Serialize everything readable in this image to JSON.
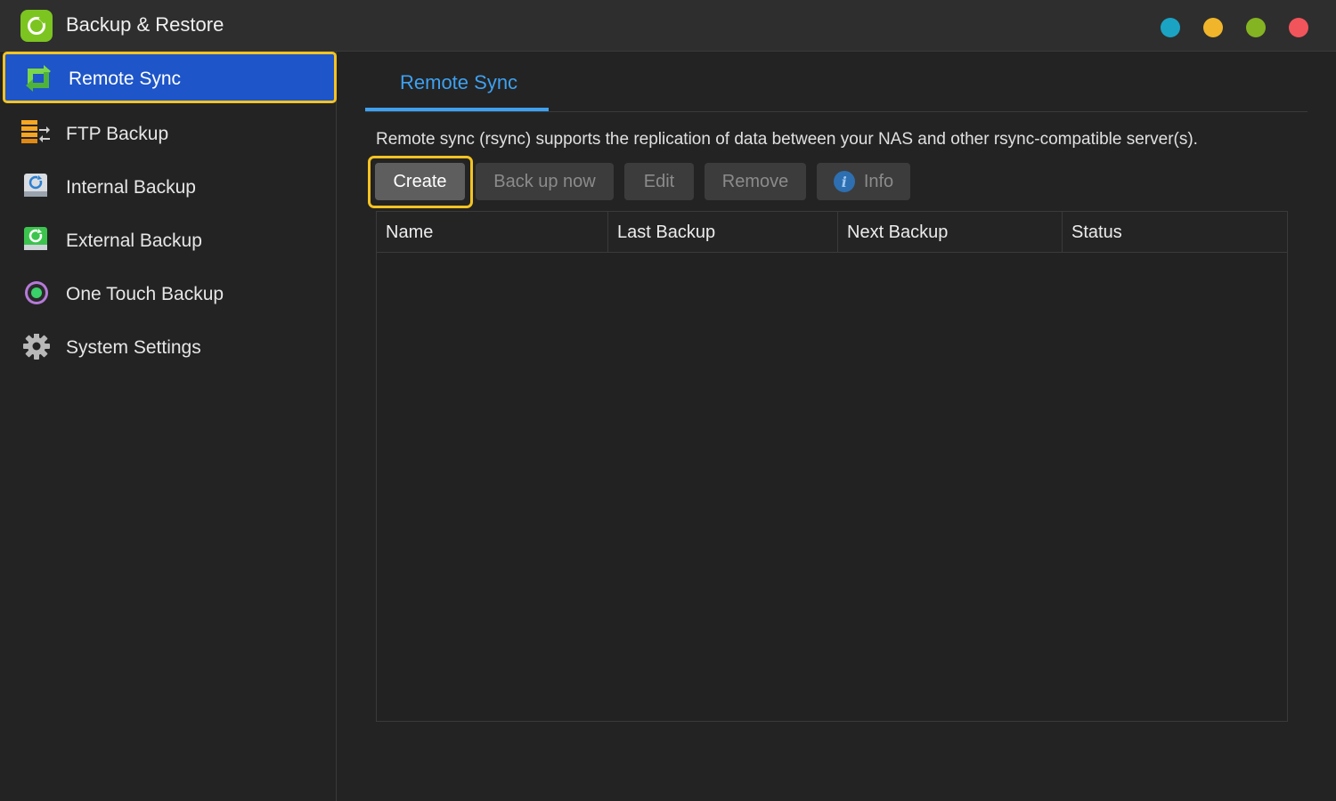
{
  "window": {
    "title": "Backup & Restore",
    "controls": [
      {
        "name": "minimize",
        "color": "#1ba3c4"
      },
      {
        "name": "maximize",
        "color": "#f0b52a"
      },
      {
        "name": "restore",
        "color": "#84b422"
      },
      {
        "name": "close",
        "color": "#f2545b"
      }
    ]
  },
  "sidebar": {
    "items": [
      {
        "label": "Remote Sync",
        "icon": "remote-sync-icon",
        "active": true
      },
      {
        "label": "FTP Backup",
        "icon": "ftp-backup-icon",
        "active": false
      },
      {
        "label": "Internal Backup",
        "icon": "internal-backup-icon",
        "active": false
      },
      {
        "label": "External Backup",
        "icon": "external-backup-icon",
        "active": false
      },
      {
        "label": "One Touch Backup",
        "icon": "one-touch-backup-icon",
        "active": false
      },
      {
        "label": "System Settings",
        "icon": "gear-icon",
        "active": false
      }
    ]
  },
  "main": {
    "tabs": [
      {
        "label": "Remote Sync",
        "active": true
      }
    ],
    "description": "Remote sync (rsync) supports the replication of data between your NAS and other rsync-compatible server(s).",
    "toolbar": {
      "create": "Create",
      "backup_now": "Back up now",
      "edit": "Edit",
      "remove": "Remove",
      "info": "Info"
    },
    "table": {
      "columns": [
        "Name",
        "Last Backup",
        "Next Backup",
        "Status"
      ],
      "rows": []
    }
  },
  "colors": {
    "accent": "#3ea1f0",
    "active_nav": "#1e55c8",
    "highlight": "#f4c322",
    "brand": "#7cc520"
  }
}
